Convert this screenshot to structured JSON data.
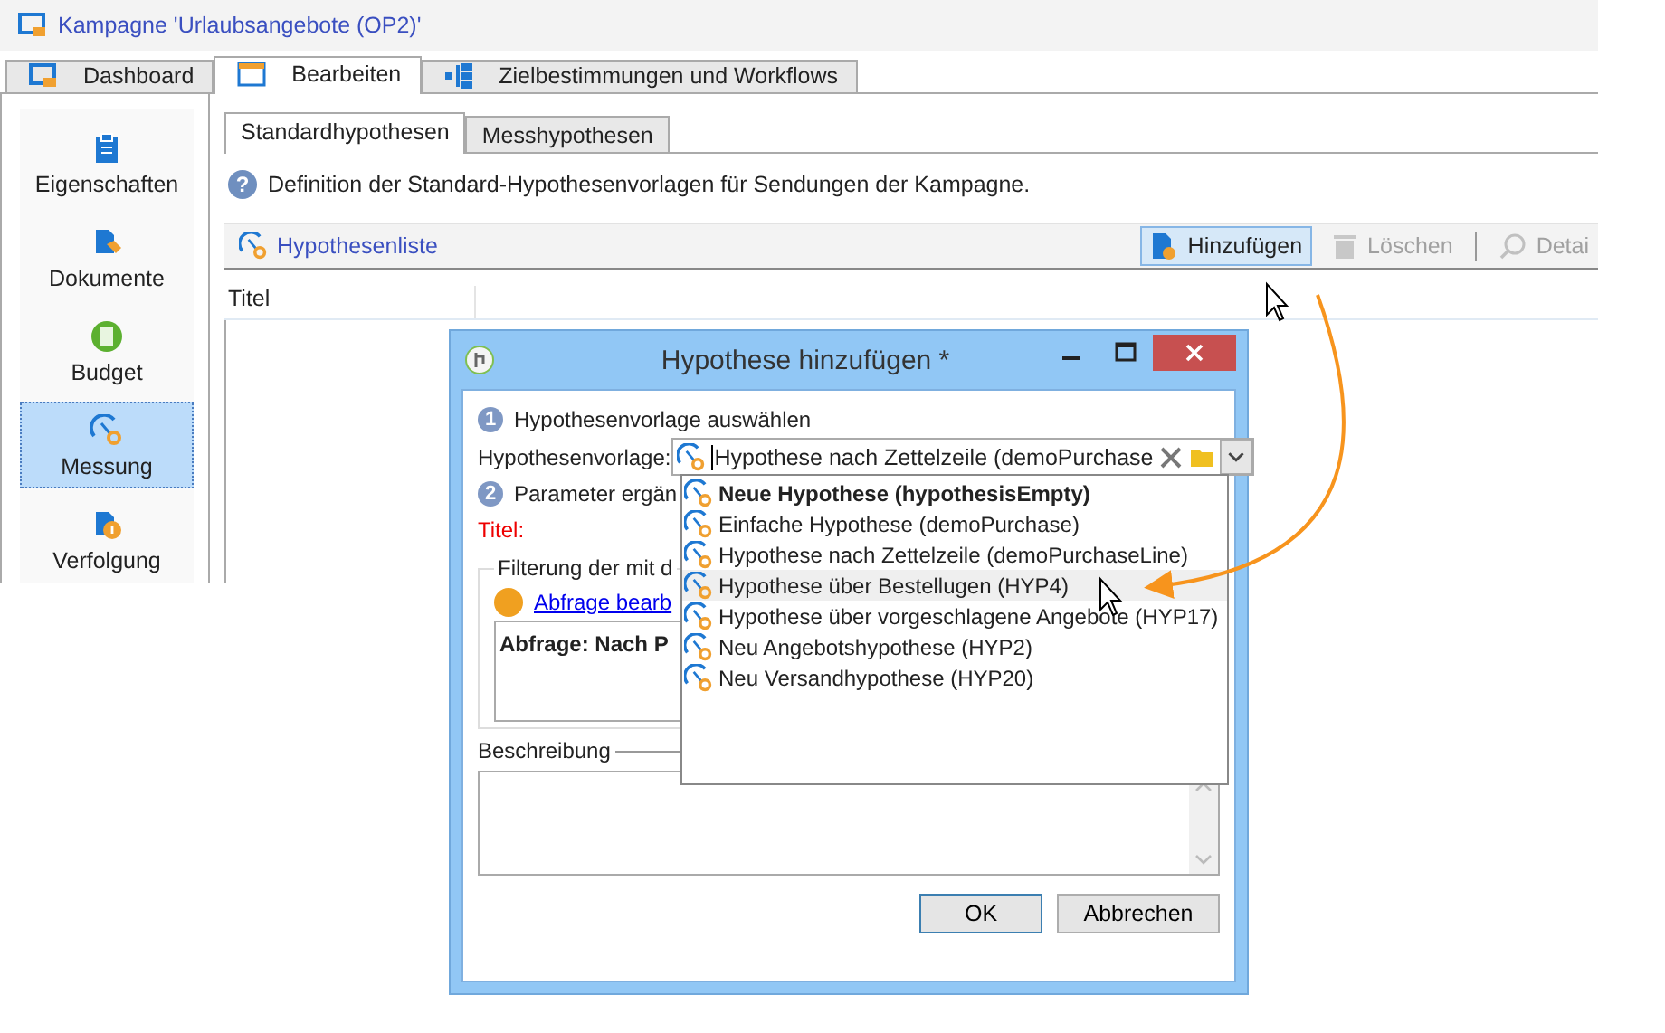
{
  "window": {
    "title": "Kampagne 'Urlaubsangebote (OP2)'"
  },
  "tabs": [
    {
      "label": "Dashboard",
      "selected": false
    },
    {
      "label": "Bearbeiten",
      "selected": true
    },
    {
      "label": "Zielbestimmungen und Workflows",
      "selected": false
    }
  ],
  "sidebar": {
    "items": [
      {
        "label": "Eigenschaften",
        "selected": false
      },
      {
        "label": "Dokumente",
        "selected": false
      },
      {
        "label": "Budget",
        "selected": false
      },
      {
        "label": "Messung",
        "selected": true
      },
      {
        "label": "Verfolgung",
        "selected": false
      }
    ]
  },
  "subtabs": [
    {
      "label": "Standardhypothesen",
      "selected": true
    },
    {
      "label": "Messhypothesen",
      "selected": false
    }
  ],
  "info_icon": "?",
  "info": "Definition der Standard-Hypothesenvorlagen für Sendungen der Kampagne.",
  "toolbar": {
    "title": "Hypothesenliste",
    "buttons": [
      {
        "label": "Hinzufügen",
        "hovered": true,
        "disabled": false
      },
      {
        "label": "Löschen",
        "hovered": false,
        "disabled": true
      },
      {
        "label": "Detai",
        "hovered": false,
        "disabled": true
      }
    ]
  },
  "table": {
    "columns": [
      "Titel"
    ]
  },
  "dialog": {
    "title": "Hypothese hinzufügen *",
    "step1": {
      "number": "1",
      "label": "Hypothesenvorlage auswählen"
    },
    "template_label": "Hypothesenvorlage:",
    "template_value": "Hypothese nach Zettelzeile (demoPurchase",
    "step2": {
      "number": "2",
      "label": "Parameter ergän"
    },
    "title_label": "Titel:",
    "filter_group": "Filterung der mit d",
    "query_link": "Abfrage bearb",
    "query_text": "Abfrage: Nach P",
    "description_label": "Beschreibung",
    "buttons": [
      "OK",
      "Abbrechen"
    ]
  },
  "dropdown": {
    "options": [
      {
        "label": "Neue Hypothese (hypothesisEmpty)",
        "kind": "empty",
        "selected": false
      },
      {
        "label": "Einfache Hypothese (demoPurchase)",
        "kind": "template",
        "selected": false
      },
      {
        "label": "Hypothese nach Zettelzeile (demoPurchaseLine)",
        "kind": "template",
        "selected": false
      },
      {
        "label": "Hypothese über Bestellugen (HYP4)",
        "kind": "template",
        "selected": true
      },
      {
        "label": "Hypothese über vorgeschlagene Angebote (HYP17)",
        "kind": "template",
        "selected": false
      },
      {
        "label": "Neu Angebotshypothese (HYP2)",
        "kind": "template",
        "selected": false
      },
      {
        "label": "Neu Versandhypothese (HYP20)",
        "kind": "template",
        "selected": false
      }
    ]
  }
}
